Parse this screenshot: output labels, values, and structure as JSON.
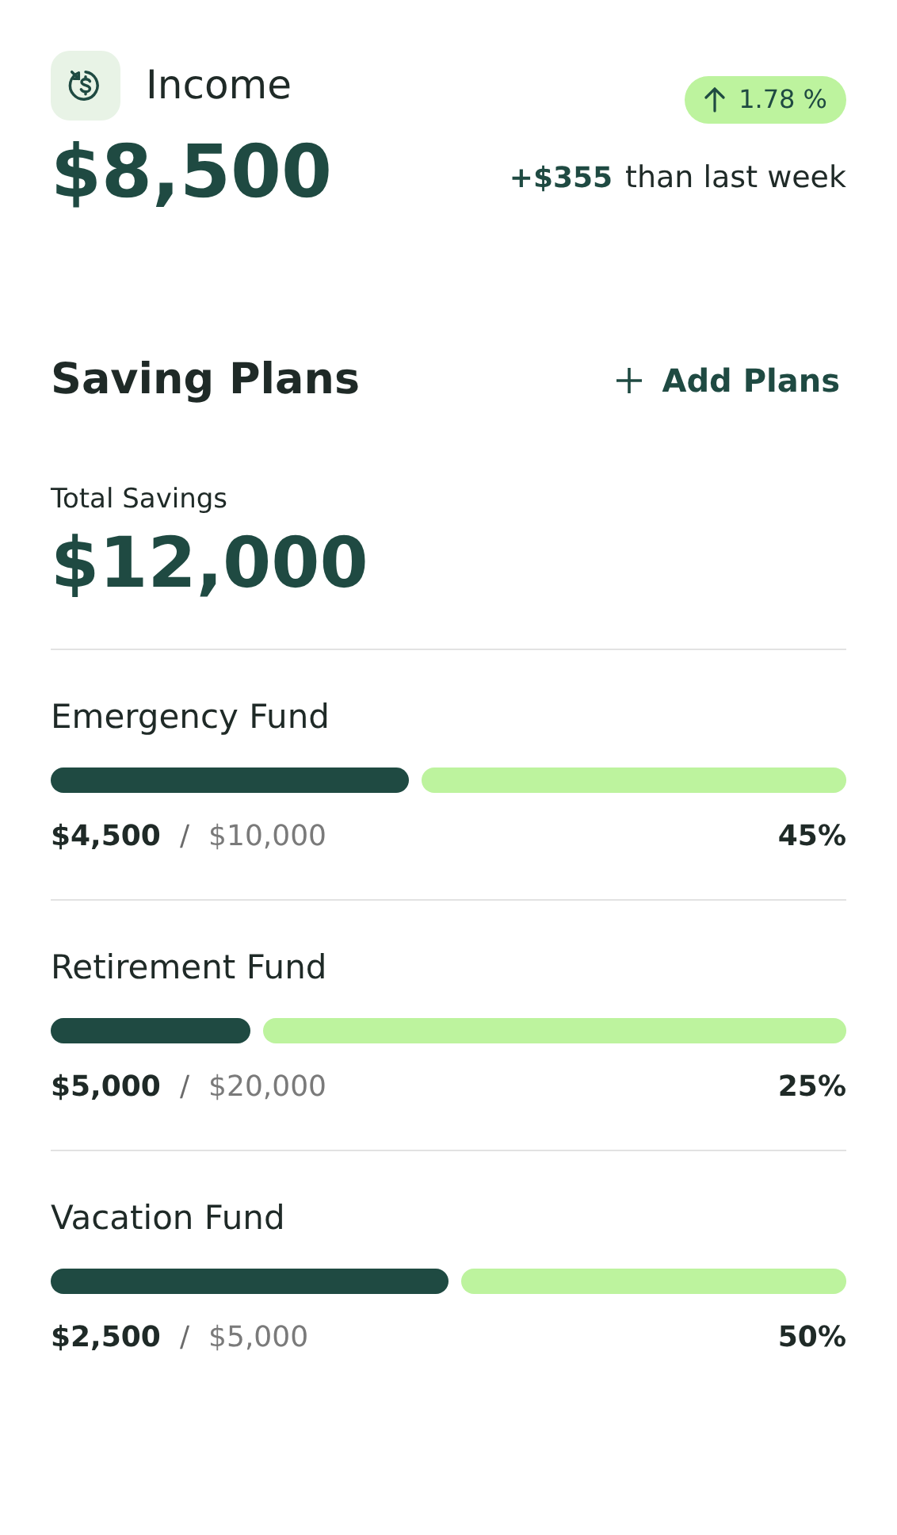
{
  "income": {
    "title": "Income",
    "amount": "$8,500",
    "change_badge": "1.78 %",
    "delta": "+$355",
    "delta_text": "than last week"
  },
  "saving_plans": {
    "title": "Saving Plans",
    "add_button": "Add Plans",
    "total_label": "Total Savings",
    "total": "$12,000",
    "plans": [
      {
        "name": "Emergency Fund",
        "level": 0.45,
        "saved": "$4,500",
        "separator": "/",
        "goal": "$10,000",
        "percent": "45%"
      },
      {
        "name": "Retirement Fund",
        "level": 0.25,
        "saved": "$5,000",
        "separator": "/",
        "goal": "$20,000",
        "percent": "25%"
      },
      {
        "name": "Vacation Fund",
        "level": 0.5,
        "saved": "$2,500",
        "separator": "/",
        "goal": "$5,000",
        "percent": "50%"
      }
    ]
  }
}
